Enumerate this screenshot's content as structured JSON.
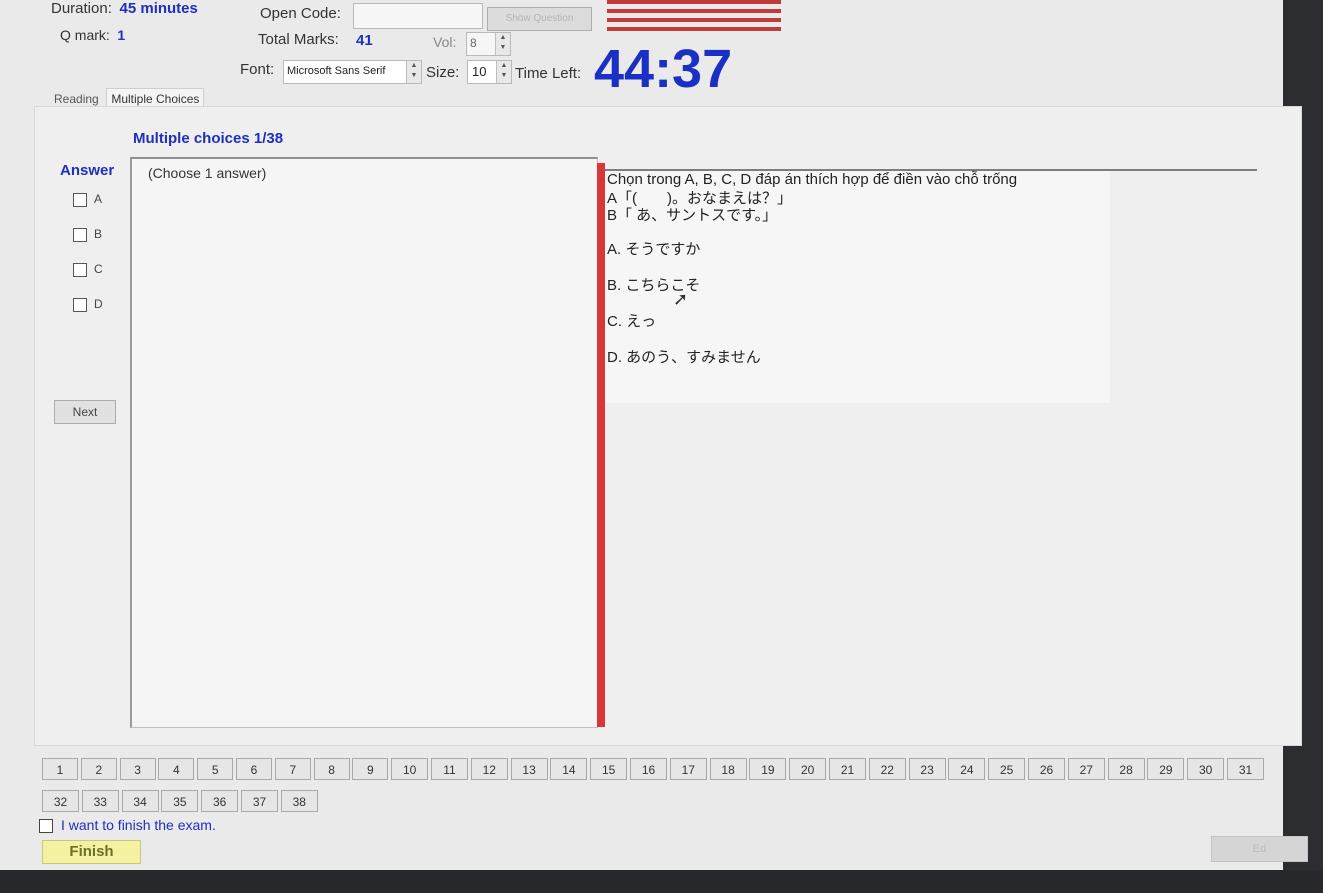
{
  "header": {
    "duration_label": "Duration:",
    "duration_value": "45 minutes",
    "qmark_label": "Q mark:",
    "qmark_value": "1",
    "open_code_label": "Open Code:",
    "open_code_value": "",
    "show_question_label": "Show Question",
    "total_marks_label": "Total Marks:",
    "total_marks_value": "41",
    "vol_label": "Vol:",
    "vol_value": "8",
    "font_label": "Font:",
    "font_value": "Microsoft Sans Serif",
    "size_label": "Size:",
    "size_value": "10",
    "time_left_label": "Time Left:",
    "time_left_value": "44:37"
  },
  "tabs": [
    {
      "label": "Reading",
      "active": false
    },
    {
      "label": "Multiple Choices",
      "active": true
    }
  ],
  "question": {
    "title": "Multiple choices 1/38",
    "answer_label": "Answer",
    "options": [
      "A",
      "B",
      "C",
      "D"
    ],
    "next_label": "Next",
    "choose_hint": "(Choose 1 answer)",
    "lines": [
      "Chọn trong A, B, C, D đáp án thích hợp để điền vào chỗ trống",
      "A「(　　)。おなまえは？」",
      "B「 あ、サントスです。」",
      "A. そうですか",
      "B. こちらこそ",
      "C. えっ",
      "D. あのう、すみません"
    ]
  },
  "navigation": {
    "row1": [
      "1",
      "2",
      "3",
      "4",
      "5",
      "6",
      "7",
      "8",
      "9",
      "10",
      "11",
      "12",
      "13",
      "14",
      "15",
      "16",
      "17",
      "18",
      "19",
      "20",
      "21",
      "22",
      "23",
      "24",
      "25",
      "26",
      "27",
      "28",
      "29",
      "30",
      "31"
    ],
    "row2": [
      "32",
      "33",
      "34",
      "35",
      "36",
      "37",
      "38"
    ]
  },
  "footer": {
    "finish_check_label": "I want to finish the exam.",
    "finish_label": "Finish",
    "end_label": "Ed"
  },
  "colors": {
    "accent_blue": "#1f2fbf",
    "timer_blue": "#1a2fc4",
    "divider_red": "#d9363c",
    "finish_yellow": "#f4f2a0"
  }
}
